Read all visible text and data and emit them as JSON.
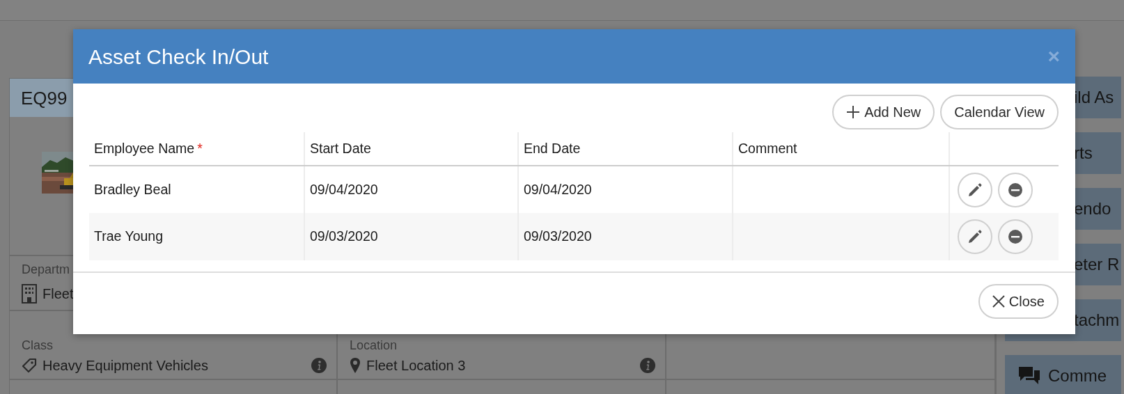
{
  "background": {
    "asset_title": "EQ99",
    "field_rows": [
      [
        {
          "label": "Departm",
          "value": "Fleet",
          "info": false
        }
      ],
      [
        {
          "label": "Class",
          "value": "Heavy Equipment Vehicles",
          "info": true
        },
        {
          "label": "Location",
          "value": "Fleet Location 3",
          "info": true
        }
      ],
      []
    ],
    "side_panels": [
      {
        "label": "ild As"
      },
      {
        "label": "rts"
      },
      {
        "label": "endo"
      },
      {
        "label": "eter R"
      },
      {
        "label": "tachm"
      },
      {
        "label": "Comme"
      }
    ]
  },
  "modal": {
    "title": "Asset Check In/Out",
    "close_glyph": "×",
    "toolbar_buttons": [
      {
        "label": "Add New",
        "kind": "add"
      },
      {
        "label": "Calendar View",
        "kind": "plain"
      }
    ],
    "table": {
      "columns": [
        {
          "label": "Employee Name",
          "required_mark": "*"
        },
        {
          "label": "Start Date"
        },
        {
          "label": "End Date"
        },
        {
          "label": "Comment"
        }
      ],
      "rows": [
        {
          "employee_name": "Bradley Beal",
          "start_date": "09/04/2020",
          "end_date": "09/04/2020"
        },
        {
          "employee_name": "Trae Young",
          "start_date": "09/03/2020",
          "end_date": "09/03/2020"
        }
      ]
    },
    "footer_button": "Close"
  }
}
